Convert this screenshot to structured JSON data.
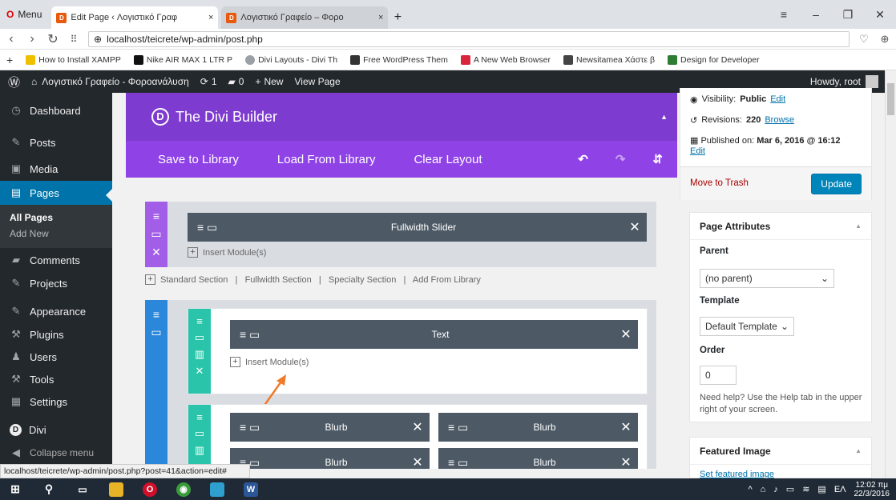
{
  "browser": {
    "menu_label": "Menu",
    "tabs": [
      {
        "title": "Edit Page ‹ Λογιστικό Γραφ",
        "close": "×"
      },
      {
        "title": "Λογιστικό Γραφείο – Φορο",
        "close": "×"
      }
    ],
    "new_tab": "+",
    "url": "localhost/teicrete/wp-admin/post.php",
    "bookmarks": [
      {
        "label": "How to Install XAMPP",
        "color": "#f0c000"
      },
      {
        "label": "Nike AIR MAX 1 LTR P",
        "color": "#111111"
      },
      {
        "label": "Divi Layouts - Divi Th",
        "color": "#9aa0a6"
      },
      {
        "label": "Free WordPress Them",
        "color": "#333333"
      },
      {
        "label": "A New Web Browser",
        "color": "#d9263c"
      },
      {
        "label": "Newsitamea Χάστε β",
        "color": "#444444"
      },
      {
        "label": "Design for Developer",
        "color": "#2e7d32"
      }
    ]
  },
  "admin_bar": {
    "site_name": "Λογιστικό Γραφείο - Φοροανάλυση",
    "updates": "1",
    "comments": "0",
    "new_label": "New",
    "view_page": "View Page",
    "howdy": "Howdy, root"
  },
  "sidebar": {
    "items": [
      {
        "label": "Dashboard",
        "icon": "◷"
      },
      {
        "label": "Posts",
        "icon": "✎"
      },
      {
        "label": "Media",
        "icon": "▣"
      },
      {
        "label": "Pages",
        "icon": "▤"
      },
      {
        "label": "Comments",
        "icon": "▰"
      },
      {
        "label": "Projects",
        "icon": "✎"
      },
      {
        "label": "Appearance",
        "icon": "✎"
      },
      {
        "label": "Plugins",
        "icon": "⚒"
      },
      {
        "label": "Users",
        "icon": "♟"
      },
      {
        "label": "Tools",
        "icon": "⚒"
      },
      {
        "label": "Settings",
        "icon": "▦"
      },
      {
        "label": "Divi",
        "icon": "D"
      },
      {
        "label": "Collapse menu",
        "icon": "◀"
      }
    ],
    "sub_items": [
      "All Pages",
      "Add New"
    ]
  },
  "builder": {
    "title": "The Divi Builder",
    "save_library": "Save to Library",
    "load_library": "Load From Library",
    "clear_layout": "Clear Layout",
    "section1_module": "Fullwidth Slider",
    "insert_module": "Insert Module(s)",
    "section_links": "Standard Section   |   Fullwidth Section   |   Specialty Section   |   Add From Library",
    "text_module": "Text",
    "blurbs": [
      "Blurb",
      "Blurb",
      "Blurb",
      "Blurb"
    ],
    "purple": "#7e3bd0",
    "purple_light": "#8f42e6",
    "teal": "#29c4a9",
    "blue": "#2b87da"
  },
  "publish": {
    "visibility_label": "Visibility:",
    "visibility_value": "Public",
    "visibility_edit": "Edit",
    "revisions_label": "Revisions:",
    "revisions_value": "220",
    "revisions_browse": "Browse",
    "published_label": "Published on:",
    "published_value": "Mar 6, 2016 @ 16:12",
    "published_edit": "Edit",
    "trash": "Move to Trash",
    "update": "Update"
  },
  "attributes": {
    "title": "Page Attributes",
    "parent_label": "Parent",
    "parent_value": "(no parent)",
    "template_label": "Template",
    "template_value": "Default Template",
    "order_label": "Order",
    "order_value": "0",
    "help": "Need help? Use the Help tab in the upper right of your screen."
  },
  "featured": {
    "title": "Featured Image",
    "link": "Set featured image"
  },
  "status_url": "localhost/teicrete/wp-admin/post.php?post=41&action=edit#",
  "taskbar": {
    "lang": "ΕΛ",
    "time": "12:02 πμ",
    "date": "22/3/2016"
  }
}
